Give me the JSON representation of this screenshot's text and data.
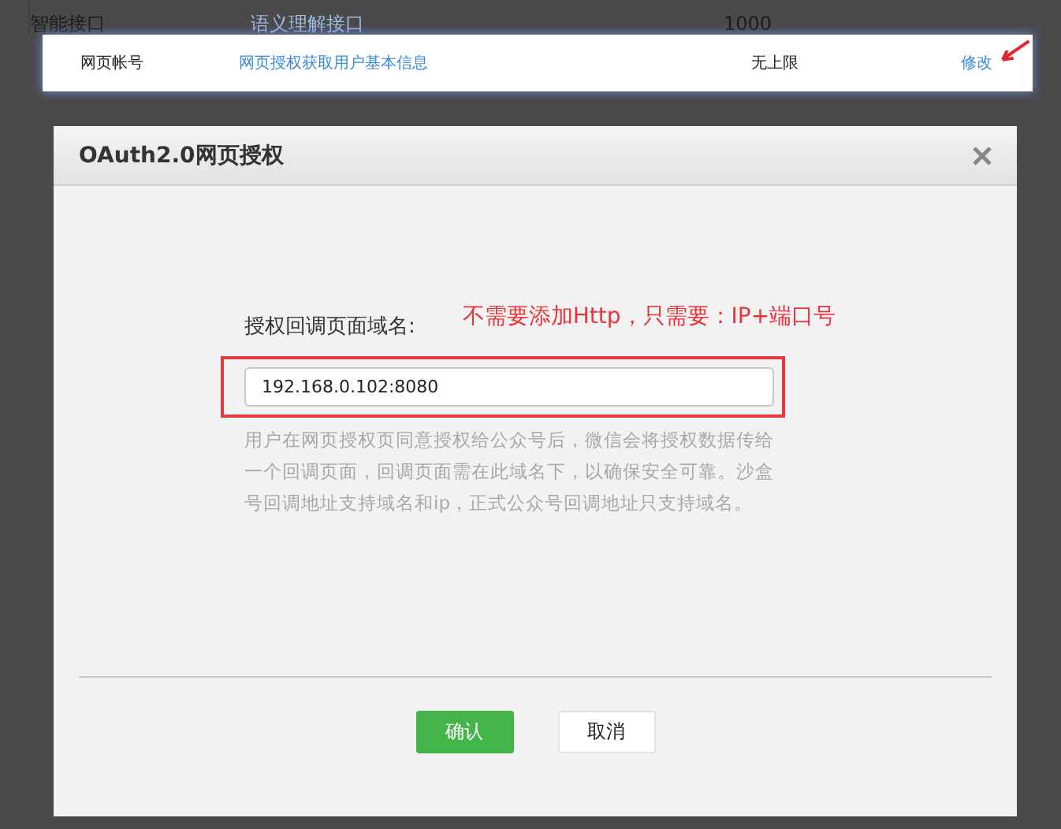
{
  "background_table": {
    "row": [
      "智能接口",
      "语义理解接口",
      "1000"
    ]
  },
  "highlighted_row": {
    "column_1": "网页帐号",
    "column_2": "网页授权获取用户基本信息",
    "column_3": "无上限",
    "column_4": "修改"
  },
  "dialog": {
    "title": "OAuth2.0网页授权",
    "field_label": "授权回调页面域名:",
    "annotation": "不需要添加Http，只需要：IP+端口号",
    "field_value": "192.168.0.102:8080",
    "help": "用户在网页授权页同意授权给公众号后，微信会将授权数据传给一个回调页面，回调页面需在此域名下，以确保安全可靠。沙盒号回调地址支持域名和ip，正式公众号回调地址只支持域名。",
    "buttons": [
      {
        "label": "确认",
        "kind": "primary"
      },
      {
        "label": "取消",
        "kind": "secondary"
      }
    ]
  }
}
